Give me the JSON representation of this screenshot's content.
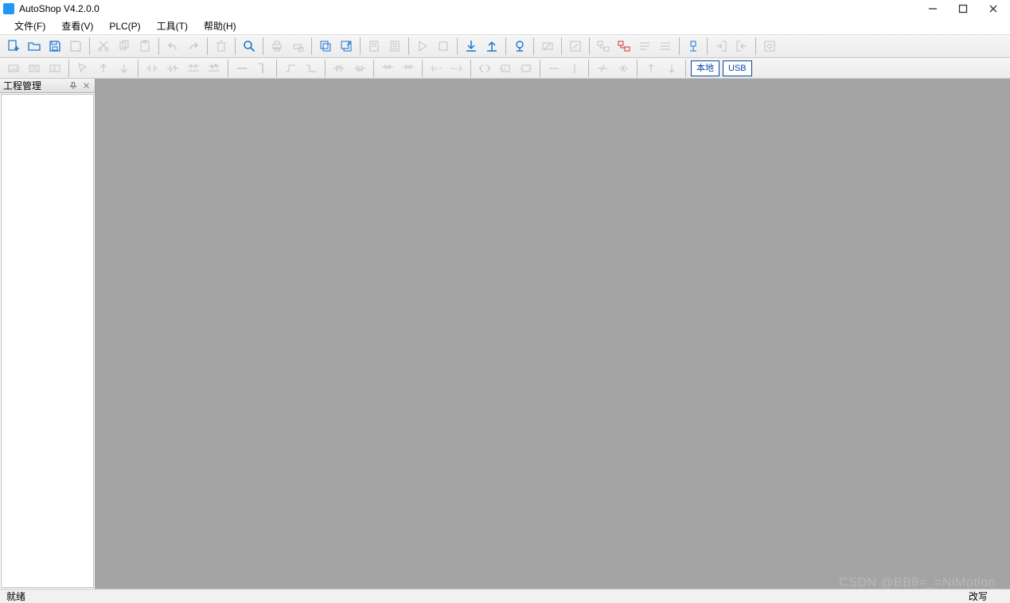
{
  "window": {
    "title": "AutoShop V4.2.0.0"
  },
  "menus": {
    "file": "文件(F)",
    "view": "查看(V)",
    "plc": "PLC(P)",
    "tools": "工具(T)",
    "help": "帮助(H)"
  },
  "toolbar2": {
    "local": "本地",
    "usb": "USB"
  },
  "panels": {
    "project_mgmt": {
      "title": "工程管理"
    }
  },
  "status": {
    "left": "就绪",
    "right": "改写"
  },
  "watermark": "CSDN @BB8=_=NiMotion"
}
